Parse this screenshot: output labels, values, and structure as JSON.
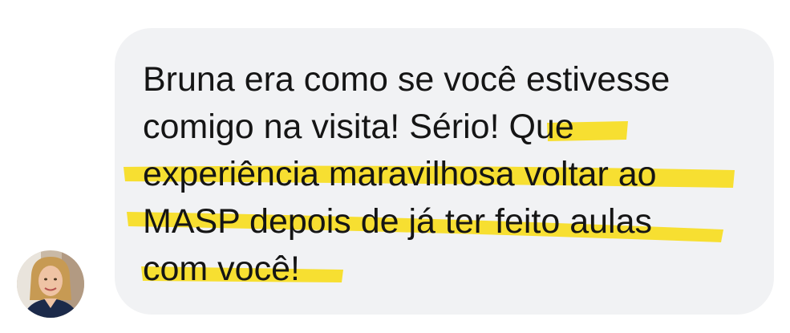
{
  "message": {
    "lines": [
      "Bruna era como se você estivesse",
      "comigo na visita! Sério! Que",
      "experiência maravilhosa voltar ao",
      "MASP depois de já ter feito aulas",
      "com você!"
    ]
  },
  "colors": {
    "bubble": "#f1f2f4",
    "highlight": "#f7dd1f",
    "text": "#151515"
  }
}
